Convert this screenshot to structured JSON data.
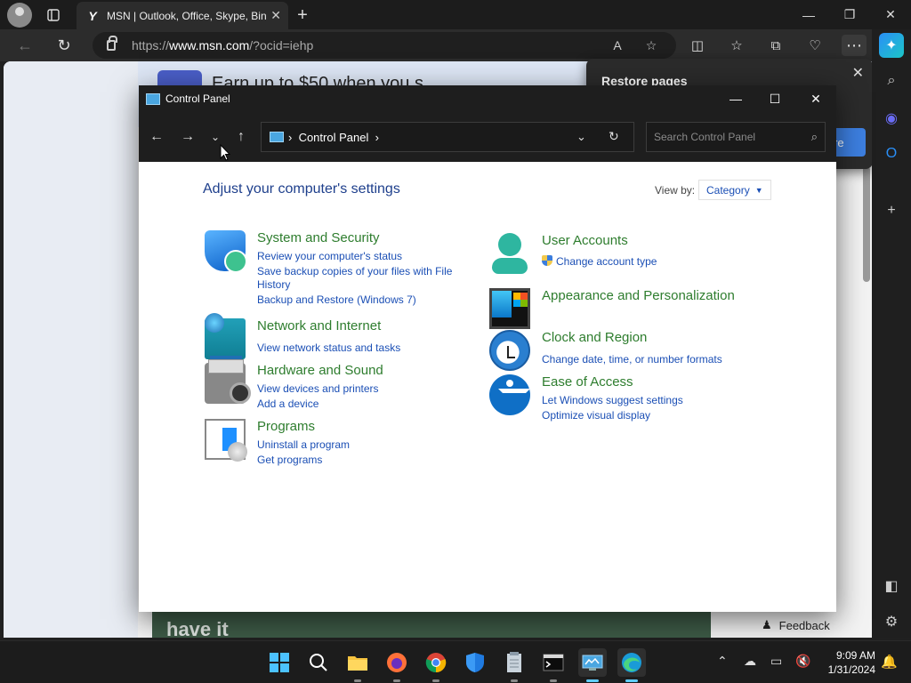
{
  "browser": {
    "tab_title": "MSN | Outlook, Office, Skype, Bing",
    "url_prefix": "https://",
    "url_host": "www.msn.com",
    "url_path": "/?ocid=iehp",
    "promo_text": "Earn up to $50 when you s",
    "banner_text": "have it",
    "feedback_label": "Feedback",
    "restore_title": "Restore pages",
    "restore_button": "re"
  },
  "control_panel": {
    "window_title": "Control Panel",
    "breadcrumb": "Control Panel",
    "search_placeholder": "Search Control Panel",
    "heading": "Adjust your computer's settings",
    "view_by_label": "View by:",
    "view_by_value": "Category",
    "categories": [
      {
        "title": "System and Security",
        "links": [
          "Review your computer's status",
          "Save backup copies of your files with File",
          "History",
          "Backup and Restore (Windows 7)"
        ]
      },
      {
        "title": "Network and Internet",
        "links": [
          "View network status and tasks"
        ]
      },
      {
        "title": "Hardware and Sound",
        "links": [
          "View devices and printers",
          "Add a device"
        ]
      },
      {
        "title": "Programs",
        "links": [
          "Uninstall a program",
          "Get programs"
        ]
      },
      {
        "title": "User Accounts",
        "links": [
          "Change account type"
        ]
      },
      {
        "title": "Appearance and Personalization",
        "links": []
      },
      {
        "title": "Clock and Region",
        "links": [
          "Change date, time, or number formats"
        ]
      },
      {
        "title": "Ease of Access",
        "links": [
          "Let Windows suggest settings",
          "Optimize visual display"
        ]
      }
    ]
  },
  "taskbar": {
    "time": "9:09 AM",
    "date": "1/31/2024"
  },
  "colors": {
    "link_blue": "#1b4fb5",
    "category_green": "#2e7d2e",
    "heading_blue": "#1e3f8c",
    "accent": "#60cdff"
  }
}
